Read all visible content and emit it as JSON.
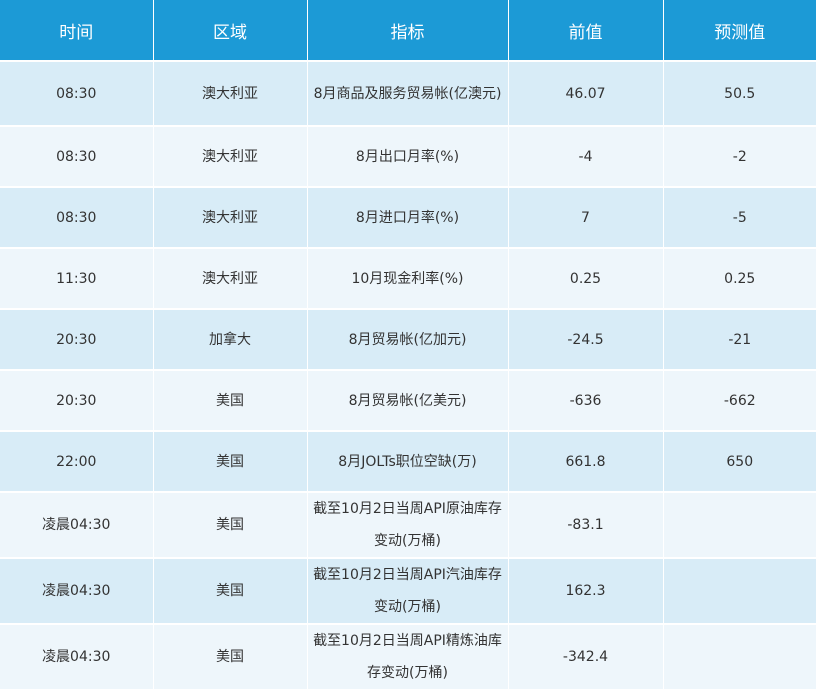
{
  "headers": [
    "时间",
    "区域",
    "指标",
    "前值",
    "预测值"
  ],
  "rows": [
    {
      "time": "08:30",
      "region": "澳大利亚",
      "indicator": "8月商品及服务贸易帐(亿澳元)",
      "previous": "46.07",
      "forecast": "50.5"
    },
    {
      "time": "08:30",
      "region": "澳大利亚",
      "indicator": "8月出口月率(%)",
      "previous": "-4",
      "forecast": "-2"
    },
    {
      "time": "08:30",
      "region": "澳大利亚",
      "indicator": "8月进口月率(%)",
      "previous": "7",
      "forecast": "-5"
    },
    {
      "time": "11:30",
      "region": "澳大利亚",
      "indicator": "10月现金利率(%)",
      "previous": "0.25",
      "forecast": "0.25"
    },
    {
      "time": "20:30",
      "region": "加拿大",
      "indicator": "8月贸易帐(亿加元)",
      "previous": "-24.5",
      "forecast": "-21"
    },
    {
      "time": "20:30",
      "region": "美国",
      "indicator": "8月贸易帐(亿美元)",
      "previous": "-636",
      "forecast": "-662"
    },
    {
      "time": "22:00",
      "region": "美国",
      "indicator": "8月JOLTs职位空缺(万)",
      "previous": "661.8",
      "forecast": "650"
    },
    {
      "time": "凌晨04:30",
      "region": "美国",
      "indicator": "截至10月2日当周API原油库存变动(万桶)",
      "previous": "-83.1",
      "forecast": ""
    },
    {
      "time": "凌晨04:30",
      "region": "美国",
      "indicator": "截至10月2日当周API汽油库存变动(万桶)",
      "previous": "162.3",
      "forecast": ""
    },
    {
      "time": "凌晨04:30",
      "region": "美国",
      "indicator": "截至10月2日当周API精炼油库存变动(万桶)",
      "previous": "-342.4",
      "forecast": ""
    }
  ]
}
